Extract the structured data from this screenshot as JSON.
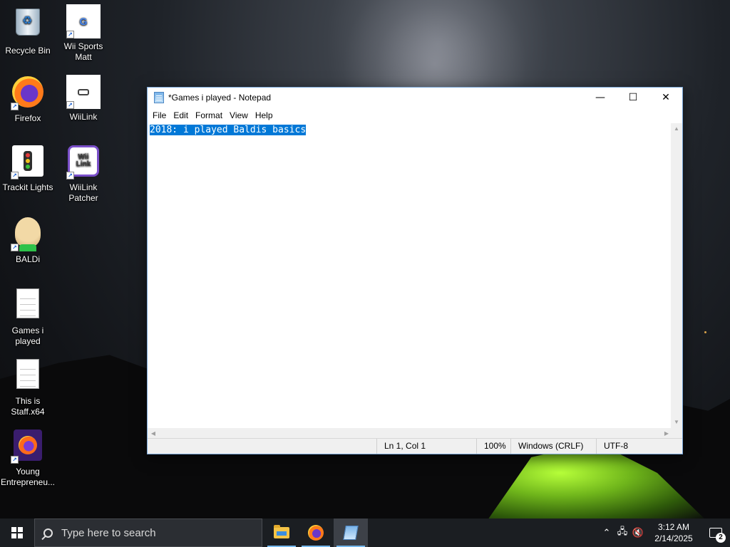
{
  "desktop": {
    "icons": [
      {
        "label": "Recycle Bin",
        "icon": "recycle-bin-icon"
      },
      {
        "label": "Wii Sports Matt",
        "icon": "google-chrome-shortcut-icon"
      },
      {
        "label": "Firefox",
        "icon": "firefox-icon"
      },
      {
        "label": "WiiLink",
        "icon": "wiilink-icon"
      },
      {
        "label": "Trackit Lights",
        "icon": "traffic-light-icon"
      },
      {
        "label": "WiiLink Patcher",
        "icon": "wiilink-patcher-icon"
      },
      {
        "label": "BALDi",
        "icon": "baldi-icon"
      },
      {
        "label": "Games i played",
        "icon": "text-document-icon"
      },
      {
        "label": "This is Staff.x64",
        "icon": "text-document-icon"
      },
      {
        "label": "Young Entrepreneu...",
        "icon": "firefox-icon"
      }
    ]
  },
  "notepad": {
    "title": "*Games i played - Notepad",
    "menu": [
      "File",
      "Edit",
      "Format",
      "View",
      "Help"
    ],
    "content": "2018: i played Baldis basics",
    "status": {
      "position": "Ln 1, Col 1",
      "zoom": "100%",
      "line_endings": "Windows (CRLF)",
      "encoding": "UTF-8"
    },
    "buttons": {
      "minimize": "—",
      "maximize": "☐",
      "close": "✕"
    }
  },
  "taskbar": {
    "search_placeholder": "Type here to search",
    "apps": [
      "File Explorer",
      "Firefox",
      "Notepad"
    ],
    "clock_time": "3:12 AM",
    "clock_date": "2/14/2025",
    "notification_count": "2"
  },
  "colors": {
    "selection": "#0078d7",
    "taskbar": "#1b1e22",
    "accent_underline": "#76b9ed"
  }
}
